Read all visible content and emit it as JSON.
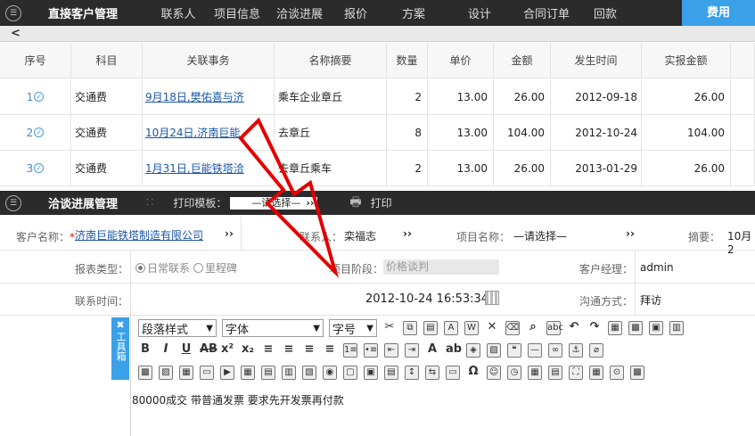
{
  "topnav": {
    "title": "直接客户管理",
    "tabs": [
      "联系人",
      "项目信息",
      "洽谈进展",
      "报价",
      "方案",
      "设计",
      "合同订单",
      "回款"
    ],
    "active_tab": "费用"
  },
  "backbar": {
    "back": "<"
  },
  "table": {
    "headers": [
      "序号",
      "科目",
      "关联事务",
      "名称摘要",
      "数量",
      "单价",
      "金额",
      "发生时间",
      "实报金额"
    ],
    "rows": [
      {
        "no": "1",
        "subject": "交通费",
        "related": "9月18日,樊佑喜与济",
        "summary": "乘车企业章丘",
        "qty": "2",
        "price": "13.00",
        "amount": "26.00",
        "date": "2012-09-18",
        "actual": "26.00"
      },
      {
        "no": "2",
        "subject": "交通费",
        "related": "10月24日,济南巨能",
        "summary": "去章丘",
        "qty": "8",
        "price": "13.00",
        "amount": "104.00",
        "date": "2012-10-24",
        "actual": "104.00"
      },
      {
        "no": "3",
        "subject": "交通费",
        "related": "1月31日,巨能铁塔洽",
        "summary": "去章丘乘车",
        "qty": "2",
        "price": "13.00",
        "amount": "26.00",
        "date": "2013-01-29",
        "actual": "26.00"
      }
    ]
  },
  "negotiation_bar": {
    "title": "洽谈进展管理",
    "print_template_label": "打印模板：",
    "print_template_value": "—请选择—",
    "print_label": "打印"
  },
  "form": {
    "customer_label": "客户名称：",
    "customer_value": "济南巨能铁塔制造有限公司",
    "contact_label": "联系人：",
    "contact_value": "栾福志",
    "project_label": "项目名称：",
    "project_value": "—请选择—",
    "summary_label": "摘要：",
    "summary_value": "10月2",
    "report_type_label": "报表类型：",
    "report_type_options": [
      "日常联系",
      "里程碑"
    ],
    "project_stage_label": "项目阶段：",
    "project_stage_value": "价格谈判",
    "manager_label": "客户经理：",
    "manager_value": "admin",
    "contact_time_label": "联系时间：",
    "contact_time_value": "2012-10-24 16:53:34",
    "comm_label": "沟通方式：",
    "comm_value": "拜访"
  },
  "toolbar": {
    "tab_label": "工具箱",
    "paragraph_style": "段落样式",
    "font": "字体",
    "font_size": "字号"
  },
  "editor": {
    "content": "80000成交 带普通发票 要求先开发票再付款"
  }
}
